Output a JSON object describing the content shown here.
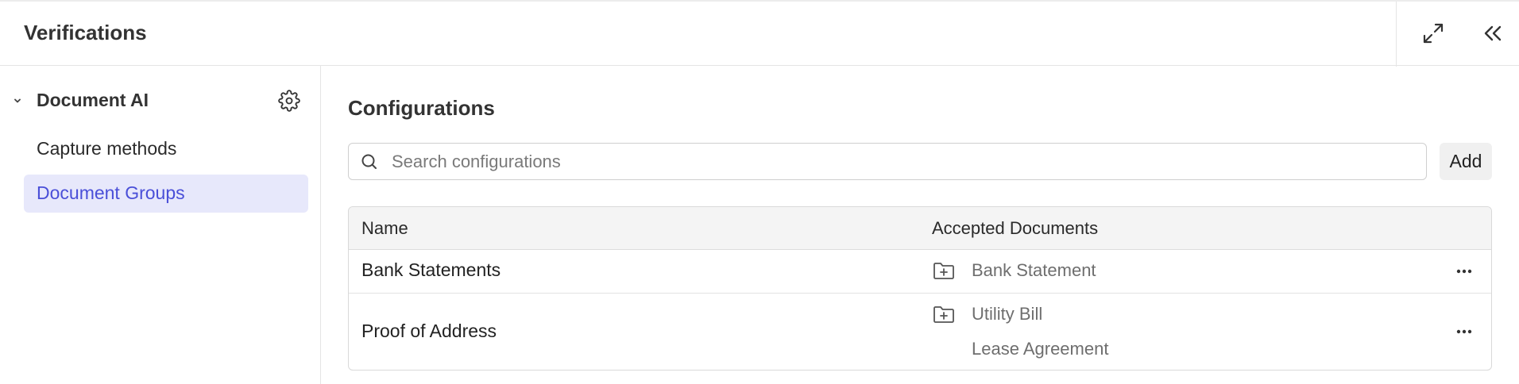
{
  "header": {
    "title": "Verifications",
    "expand_icon": "expand-icon",
    "collapse_icon": "double-chevron-left-icon"
  },
  "sidebar": {
    "group": {
      "label": "Document AI",
      "settings_icon": "gear-icon",
      "chevron_icon": "chevron-down-icon"
    },
    "items": [
      {
        "label": "Capture methods",
        "active": false
      },
      {
        "label": "Document Groups",
        "active": true
      }
    ]
  },
  "main": {
    "title": "Configurations",
    "search": {
      "placeholder": "Search configurations",
      "value": "",
      "icon": "search-icon"
    },
    "add_label": "Add",
    "table": {
      "columns": [
        "Name",
        "Accepted Documents"
      ],
      "rows": [
        {
          "name": "Bank Statements",
          "documents": [
            "Bank Statement"
          ]
        },
        {
          "name": "Proof of Address",
          "documents": [
            "Utility Bill",
            "Lease Agreement"
          ]
        }
      ],
      "row_icon": "folder-plus-icon",
      "menu_icon": "more-horizontal-icon"
    }
  },
  "colors": {
    "accent": "#4a4fd8",
    "active_bg": "#e7e8fb",
    "table_header_bg": "#f4f4f4",
    "border": "#d9d9d9"
  }
}
